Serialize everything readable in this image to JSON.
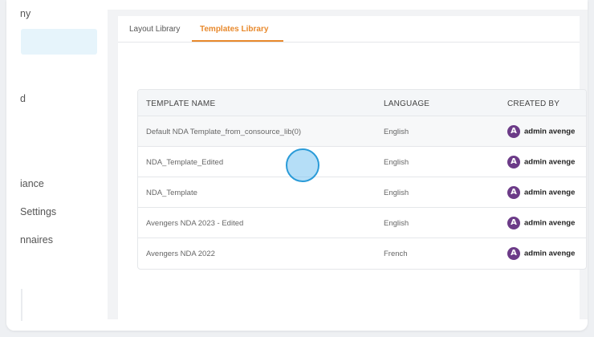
{
  "sidebar": {
    "items": [
      {
        "label": "ny"
      },
      {
        "label": "d"
      },
      {
        "label": "iance"
      },
      {
        "label": "Settings"
      },
      {
        "label": "nnaires"
      }
    ]
  },
  "tabs": [
    {
      "label": "Layout Library",
      "active": false
    },
    {
      "label": "Templates Library",
      "active": true
    }
  ],
  "table": {
    "columns": [
      "TEMPLATE NAME",
      "LANGUAGE",
      "CREATED BY"
    ],
    "rows": [
      {
        "name": "Default NDA Template_from_consource_lib(0)",
        "language": "English",
        "created_by": "admin avenge"
      },
      {
        "name": "NDA_Template_Edited",
        "language": "English",
        "created_by": "admin avenge"
      },
      {
        "name": "NDA_Template",
        "language": "English",
        "created_by": "admin avenge"
      },
      {
        "name": "Avengers NDA 2023 - Edited",
        "language": "English",
        "created_by": "admin avenge"
      },
      {
        "name": "Avengers NDA 2022",
        "language": "French",
        "created_by": "admin avenge"
      }
    ]
  },
  "colors": {
    "accent": "#e8892c",
    "sidebar_active": "#e6f4fb",
    "avatar": "#6c3b88"
  },
  "icons": {
    "avatar": "avengers-logo-icon"
  }
}
